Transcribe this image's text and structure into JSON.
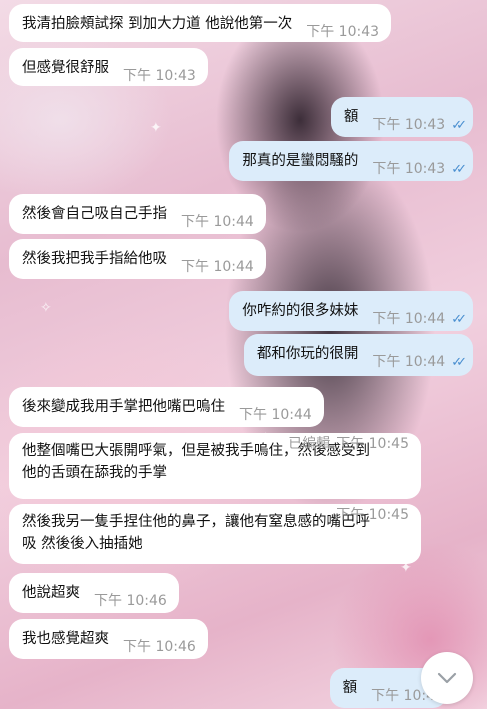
{
  "messages": [
    {
      "dir": "in",
      "text": "我清拍臉頰試探 到加大力道 他說他第一次",
      "time": "下午 10:43"
    },
    {
      "dir": "in",
      "text": "但感覺很舒服",
      "time": "下午 10:43"
    },
    {
      "dir": "out",
      "text": "額",
      "time": "下午 10:43",
      "status": "read"
    },
    {
      "dir": "out",
      "text": "那真的是蠻悶騷的",
      "time": "下午 10:43",
      "status": "read"
    },
    {
      "dir": "in",
      "text": "然後會自己吸自己手指",
      "time": "下午 10:44"
    },
    {
      "dir": "in",
      "text": "然後我把我手指給他吸",
      "time": "下午 10:44"
    },
    {
      "dir": "out",
      "text": "你咋約的很多妹妹",
      "time": "下午 10:44",
      "status": "read"
    },
    {
      "dir": "out",
      "text": "都和你玩的很開",
      "time": "下午 10:44",
      "status": "read"
    },
    {
      "dir": "in",
      "text": "後來變成我用手掌把他嘴巴嗚住",
      "time": "下午 10:44"
    },
    {
      "dir": "in",
      "text_lines": [
        "他整個嘴巴大張開呼氣，但是被我手嗚住，然後感受到",
        "他的舌頭在舔我的手掌"
      ],
      "edited": "已編輯",
      "time": "下午 10:45"
    },
    {
      "dir": "in",
      "text_lines": [
        "然後我另一隻手捏住他的鼻子，讓他有窒息感的嘴巴呼",
        "吸 然後後入抽插她"
      ],
      "time": "下午 10:45"
    },
    {
      "dir": "in",
      "text": "他說超爽",
      "time": "下午 10:46"
    },
    {
      "dir": "in",
      "text": "我也感覺超爽",
      "time": "下午 10:46"
    },
    {
      "dir": "out",
      "text": "額",
      "time": "下午 10:4"
    }
  ],
  "colors": {
    "incoming_bubble": "#ffffff",
    "outgoing_bubble": "#dcecfa",
    "read_check": "#4a8fd0",
    "timestamp": "#9a9a9a"
  },
  "icons": {
    "read_status": "double-check-icon",
    "scroll_down": "chevron-down-icon"
  }
}
